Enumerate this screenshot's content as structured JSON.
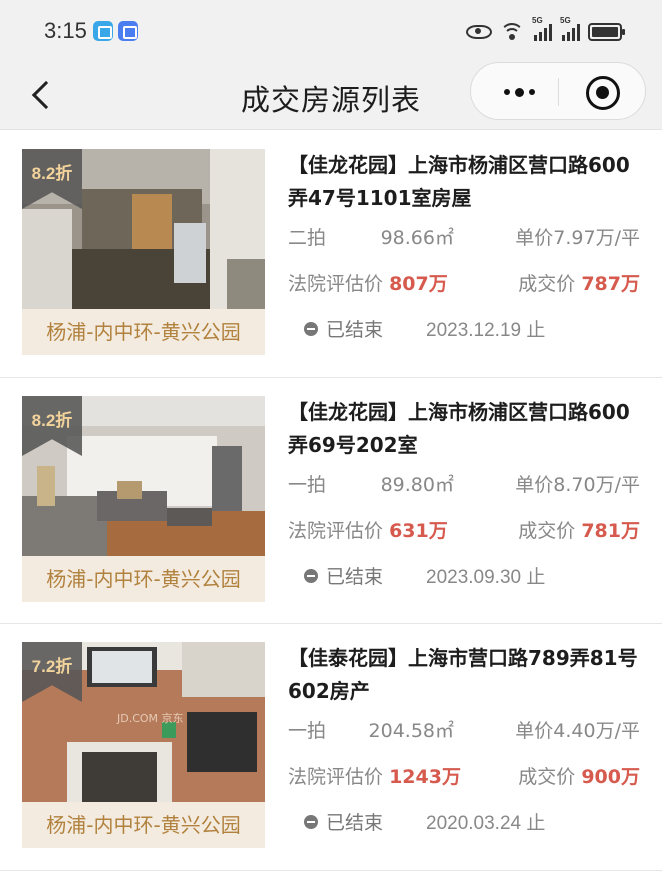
{
  "status_bar": {
    "time": "3:15",
    "signal_1_label": "5G",
    "signal_2_label": "5G",
    "icons": [
      "book-app-icon",
      "mail-app-icon",
      "eye-icon",
      "wifi-icon",
      "signal-icon",
      "signal-icon",
      "battery-icon"
    ]
  },
  "header": {
    "title": "成交房源列表",
    "icons": [
      "back-icon",
      "more-icon",
      "close-icon"
    ]
  },
  "listings": [
    {
      "discount": "8.2折",
      "district": "杨浦-内中环-黄兴公园",
      "title": "【佳龙花园】上海市杨浦区营口路600弄47号1101室房屋",
      "round": "二拍",
      "area": "98.66㎡",
      "unit_price": "单价7.97万/平",
      "court_label": "法院评估价",
      "court_value": "807万",
      "deal_label": "成交价",
      "deal_value": "787万",
      "status": "已结束",
      "end_date": "2023.12.19 止",
      "photo_colors": [
        "#8a8376",
        "#c9c4b8",
        "#4a4438",
        "#b88a52"
      ]
    },
    {
      "discount": "8.2折",
      "district": "杨浦-内中环-黄兴公园",
      "title": "【佳龙花园】上海市杨浦区营口路600弄69号202室",
      "round": "一拍",
      "area": "89.80㎡",
      "unit_price": "单价8.70万/平",
      "court_label": "法院评估价",
      "court_value": "631万",
      "deal_label": "成交价",
      "deal_value": "781万",
      "status": "已结束",
      "end_date": "2023.09.30 止",
      "photo_colors": [
        "#d8d6d2",
        "#e8e6e2",
        "#a66b3e",
        "#5a5a5a"
      ]
    },
    {
      "discount": "7.2折",
      "district": "杨浦-内中环-黄兴公园",
      "title": "【佳泰花园】上海市营口路789弄81号602房产",
      "round": "一拍",
      "area": "204.58㎡",
      "unit_price": "单价4.40万/平",
      "court_label": "法院评估价",
      "court_value": "1243万",
      "deal_label": "成交价",
      "deal_value": "900万",
      "status": "已结束",
      "end_date": "2020.03.24 止",
      "watermark": "JD.COM 京东",
      "photo_colors": [
        "#b57a5a",
        "#c8906c",
        "#e9e6df",
        "#2f2f2f"
      ]
    }
  ],
  "colors": {
    "accent_price": "#d65a4e",
    "district_text": "#b1823e",
    "district_bg": "#f4ebe0",
    "badge_text": "#f2d39c",
    "header_bg": "#f1f1f1"
  }
}
